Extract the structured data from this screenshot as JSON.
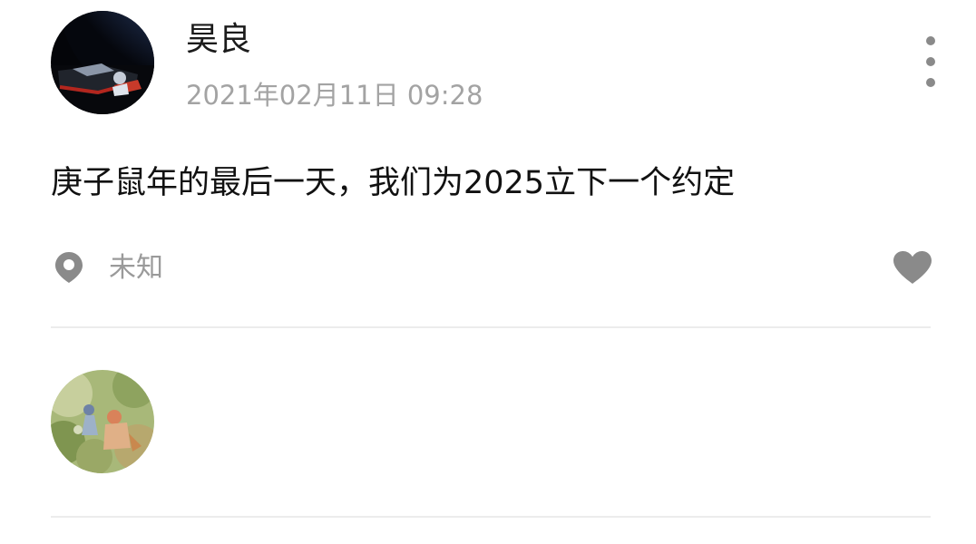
{
  "post": {
    "author": "昊良",
    "timestamp": "2021年02月11日 09:28",
    "text": "庚子鼠年的最后一天，我们为2025立下一个约定",
    "location": "未知"
  },
  "icons": {
    "more": "more-vertical-icon",
    "location": "location-pin-icon",
    "like": "heart-icon"
  },
  "colors": {
    "text_primary": "#111111",
    "text_secondary": "#a3a3a3",
    "icon_gray": "#8a8a8a",
    "divider": "#ececec"
  }
}
